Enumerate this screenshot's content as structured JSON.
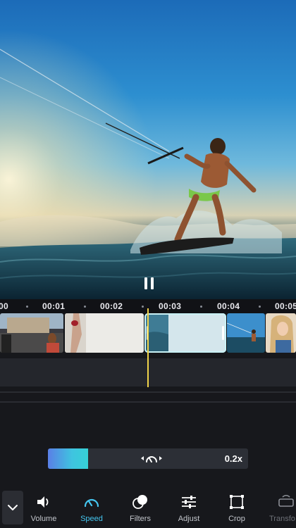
{
  "preview": {
    "controls": {
      "pause_icon": "pause-icon"
    }
  },
  "timeline": {
    "ticks": [
      "00",
      "00:01",
      "00:02",
      "00:03",
      "00:04",
      "00:05"
    ],
    "clips": [
      "clip-tourist-street",
      "clip-fashion-model",
      "clip-ocean-waves-selected",
      "clip-kitesurfer",
      "clip-blonde-woman"
    ]
  },
  "speed": {
    "value_label": "0.2x",
    "level": 0.2,
    "icon": "speedometer-icon"
  },
  "toolbar": {
    "collapse_icon": "chevron-down-icon",
    "active_tool": "Speed",
    "active_color": "#45c6f0",
    "items": [
      {
        "label": "Volume",
        "icon": "volume-icon"
      },
      {
        "label": "Speed",
        "icon": "speed-icon"
      },
      {
        "label": "Filters",
        "icon": "filters-icon"
      },
      {
        "label": "Adjust",
        "icon": "adjust-icon"
      },
      {
        "label": "Crop",
        "icon": "crop-icon"
      },
      {
        "label": "Transfo",
        "icon": "transform-icon"
      }
    ]
  }
}
